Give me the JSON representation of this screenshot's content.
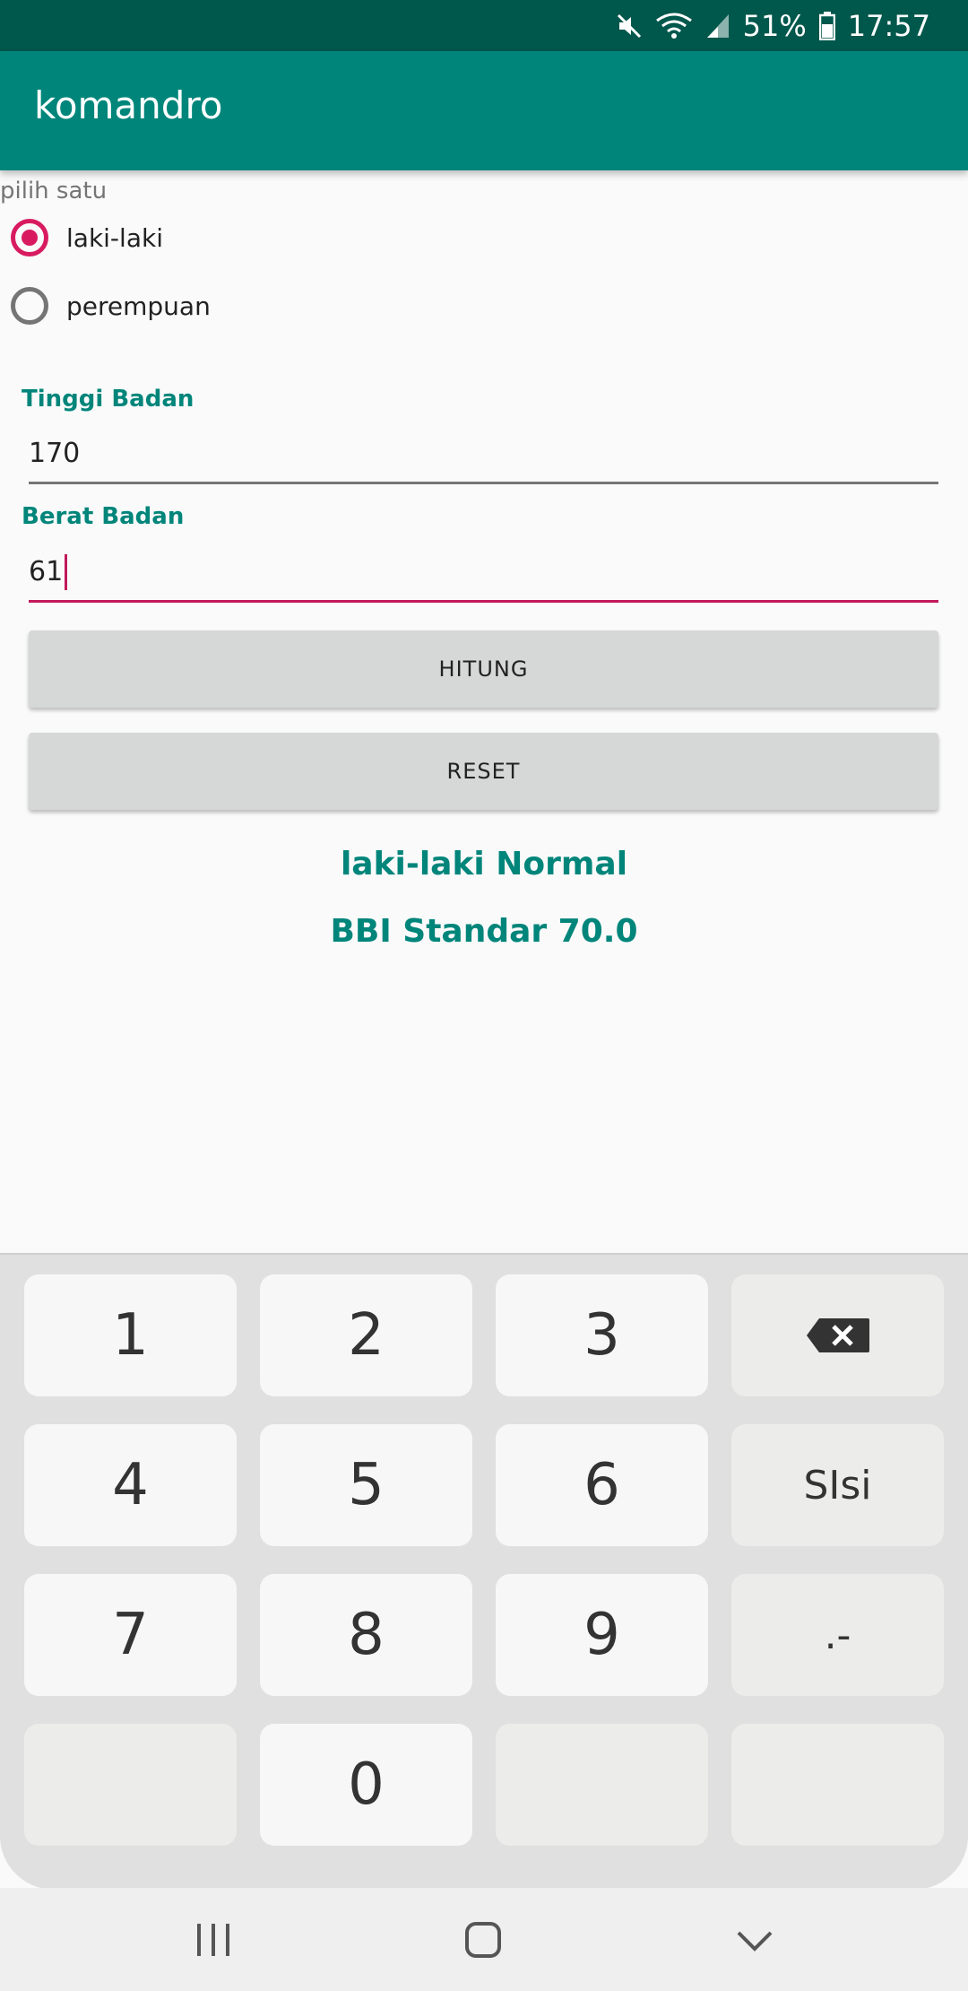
{
  "status_bar": {
    "battery": "51%",
    "time": "17:57",
    "icons": [
      "mute-icon",
      "wifi-icon",
      "signal-icon",
      "battery-icon"
    ]
  },
  "app_bar": {
    "title": "komandro"
  },
  "gender": {
    "hint": "pilih satu",
    "options": [
      {
        "label": "laki-laki",
        "checked": true
      },
      {
        "label": "perempuan",
        "checked": false
      }
    ]
  },
  "fields": {
    "height": {
      "label": "Tinggi Badan",
      "value": "170"
    },
    "weight": {
      "label": "Berat Badan",
      "value": "61"
    }
  },
  "buttons": {
    "calculate": "HITUNG",
    "reset": "RESET"
  },
  "results": {
    "status": "laki-laki Normal",
    "bbi": "BBI Standar 70.0"
  },
  "keyboard": {
    "keys": [
      "1",
      "2",
      "3",
      "backspace-icon",
      "4",
      "5",
      "6",
      "SIsi",
      "7",
      "8",
      "9",
      ".-",
      "",
      "0",
      "",
      ""
    ]
  },
  "colors": {
    "status_bar": "#00574b",
    "app_bar": "#00857a",
    "accent": "#d81b60",
    "label_teal": "#00857a"
  }
}
